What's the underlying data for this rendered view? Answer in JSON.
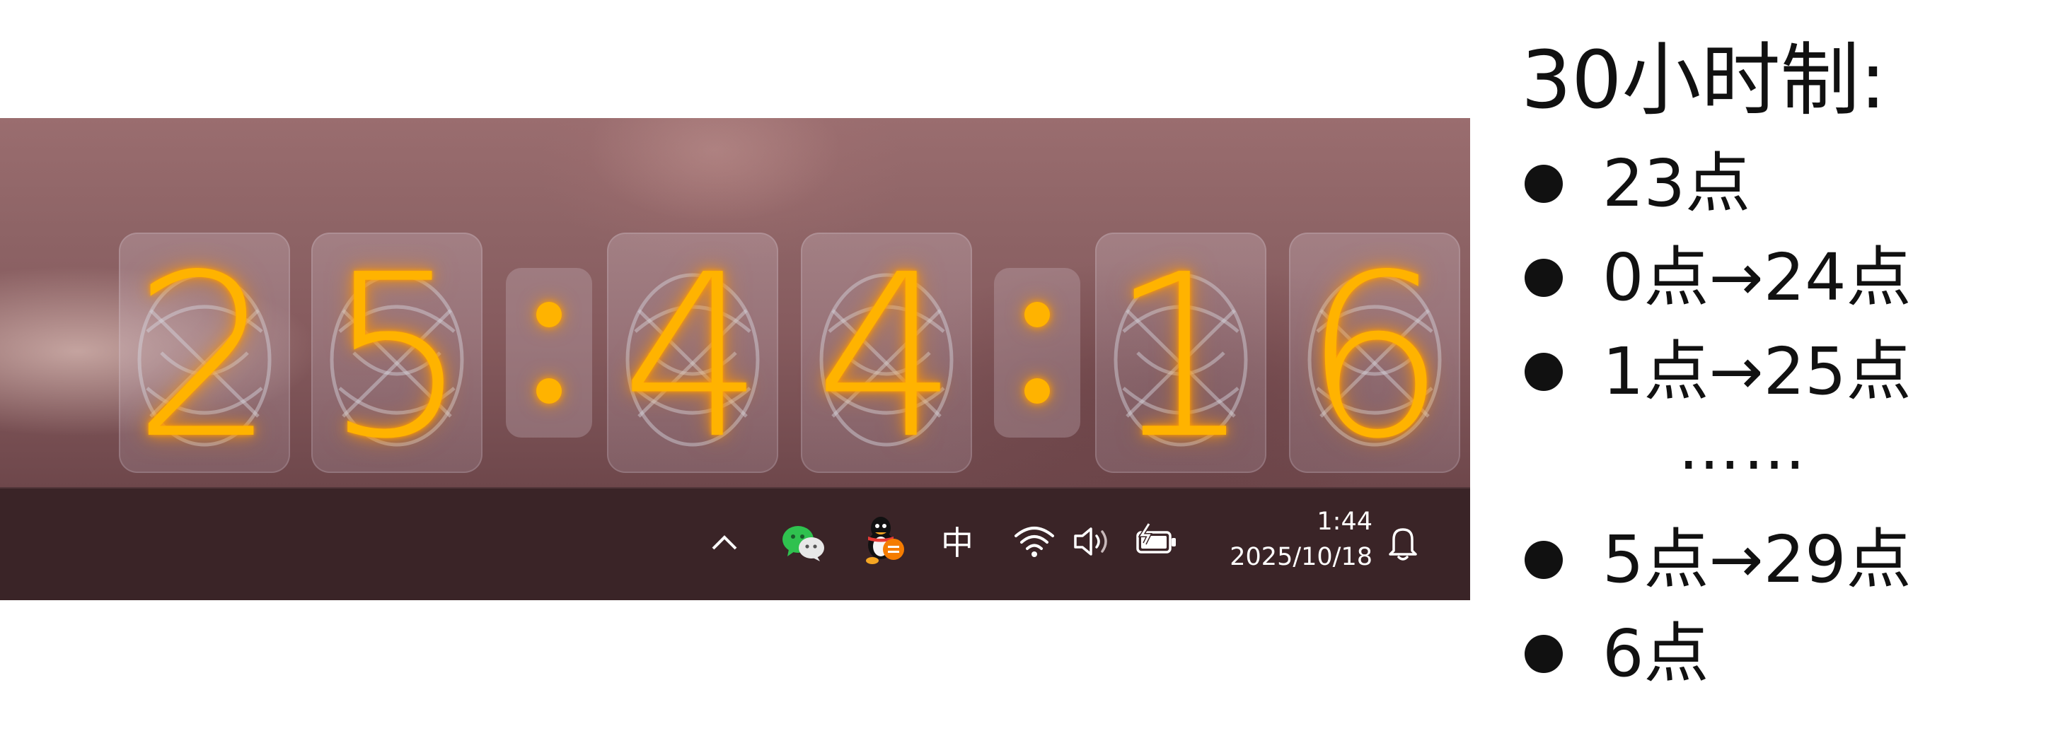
{
  "clock_widget": {
    "digits": [
      "2",
      "5",
      "4",
      "4",
      "1",
      "6"
    ]
  },
  "taskbar": {
    "icons": [
      "chevron-up-icon",
      "wechat-icon",
      "qq-icon",
      "input-method-icon",
      "wifi-icon",
      "volume-icon",
      "battery-charging-icon",
      "notification-bell-icon"
    ],
    "ime_label": "中",
    "time": "1:44",
    "date": "2025/10/18"
  },
  "notes": {
    "title": "30小时制:",
    "items": [
      "23点",
      "0点→24点",
      "1点→25点",
      "5点→29点",
      "6点"
    ],
    "ellipsis": "……"
  },
  "colors": {
    "nixie_glow": "#ffb300",
    "taskbar_bg": "#3a2427",
    "text": "#111111"
  }
}
